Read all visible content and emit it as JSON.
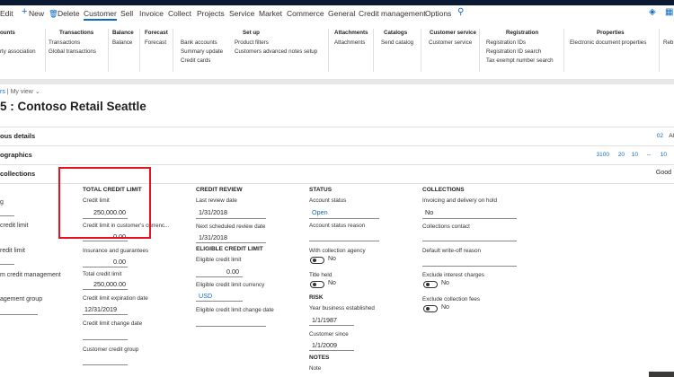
{
  "menu": {
    "items": [
      "Edit",
      "New",
      "Delete",
      "Customer",
      "Sell",
      "Invoice",
      "Collect",
      "Projects",
      "Service",
      "Market",
      "Commerce",
      "General",
      "Credit management",
      "Options"
    ],
    "active": "Customer"
  },
  "ribbon": {
    "groups": [
      {
        "title": "ounts",
        "items": [
          "",
          "rty association"
        ]
      },
      {
        "title": "Transactions",
        "items": [
          "Transactions",
          "Global transactions"
        ]
      },
      {
        "title": "Balance",
        "items": [
          "Balance"
        ]
      },
      {
        "title": "Forecast",
        "items": [
          "Forecast"
        ]
      },
      {
        "title": "Set up",
        "items": [
          "Bank accounts",
          "Summary update",
          "Credit cards",
          "Product filters",
          "Customers advanced notes setup"
        ]
      },
      {
        "title": "Attachments",
        "items": [
          "Attachments"
        ]
      },
      {
        "title": "Catalogs",
        "items": [
          "Send catalog"
        ]
      },
      {
        "title": "Customer service",
        "items": [
          "Customer service"
        ]
      },
      {
        "title": "Registration",
        "items": [
          "Registration IDs",
          "Registration ID search",
          "Tax exempt number search"
        ]
      },
      {
        "title": "Properties",
        "items": [
          "Electronic document properties"
        ]
      },
      {
        "title": "Reb",
        "items": []
      }
    ]
  },
  "breadcrumb": {
    "link": "rs",
    "sep": "|",
    "view": "My view"
  },
  "page_title": "5 : Contoso Retail Seattle",
  "fasttabs": {
    "t1": {
      "label": "ous details",
      "right": "02",
      "right2": "Al"
    },
    "t2": {
      "label": "ographics",
      "chips": [
        "3100",
        "20",
        "10",
        "--",
        "10"
      ]
    },
    "t3": {
      "label": "collections",
      "right": "Good"
    }
  },
  "left_col": {
    "labels": [
      "g",
      "credit limit",
      "redit limit",
      "m credit management",
      "agement group"
    ]
  },
  "total_credit_limit": {
    "header": "TOTAL CREDIT LIMIT",
    "credit_limit_label": "Credit limit",
    "credit_limit_value": "250,000.00",
    "credit_limit_currency_label": "Credit limit in customer's currenc...",
    "credit_limit_currency_value": "0.00",
    "insurance_label": "Insurance and guarantees",
    "insurance_value": "0.00",
    "total_label": "Total credit limit",
    "total_value": "250,000.00",
    "expiration_label": "Credit limit expiration date",
    "expiration_value": "12/31/2019",
    "change_date_label": "Credit limit change date",
    "change_date_value": "",
    "group_label": "Customer credit group",
    "group_value": ""
  },
  "credit_review": {
    "header": "CREDIT REVIEW",
    "last_review_label": "Last review date",
    "last_review_value": "1/31/2018",
    "next_review_label": "Next scheduled review date",
    "next_review_value": "1/31/2018",
    "eligible_header": "ELIGIBLE CREDIT LIMIT",
    "eligible_label": "Eligible credit limit",
    "eligible_value": "0.00",
    "eligible_currency_label": "Eligible credit limit currency",
    "eligible_currency_value": "USD",
    "eligible_change_label": "Eligible credit limit change date"
  },
  "status": {
    "header": "STATUS",
    "account_status_label": "Account status",
    "account_status_value": "Open",
    "account_status_reason_label": "Account status reason",
    "agency_label": "With collection agency",
    "agency_value": "No",
    "title_held_label": "Title held",
    "title_held_value": "No",
    "risk_header": "RISK",
    "year_established_label": "Year business established",
    "year_established_value": "1/1/1987",
    "customer_since_label": "Customer since",
    "customer_since_value": "1/1/2009",
    "notes_header": "NOTES",
    "note_label": "Note"
  },
  "collections": {
    "header": "COLLECTIONS",
    "invoicing_label": "Invoicing and delivery on hold",
    "invoicing_value": "No",
    "contact_label": "Collections contact",
    "writeoff_label": "Default write-off reason",
    "exclude_interest_label": "Exclude interest charges",
    "exclude_interest_value": "No",
    "exclude_fees_label": "Exclude collection fees",
    "exclude_fees_value": "No"
  },
  "colors": {
    "accent": "#0f6cbd",
    "highlight": "#e81123",
    "topbar": "#0b1a33"
  }
}
